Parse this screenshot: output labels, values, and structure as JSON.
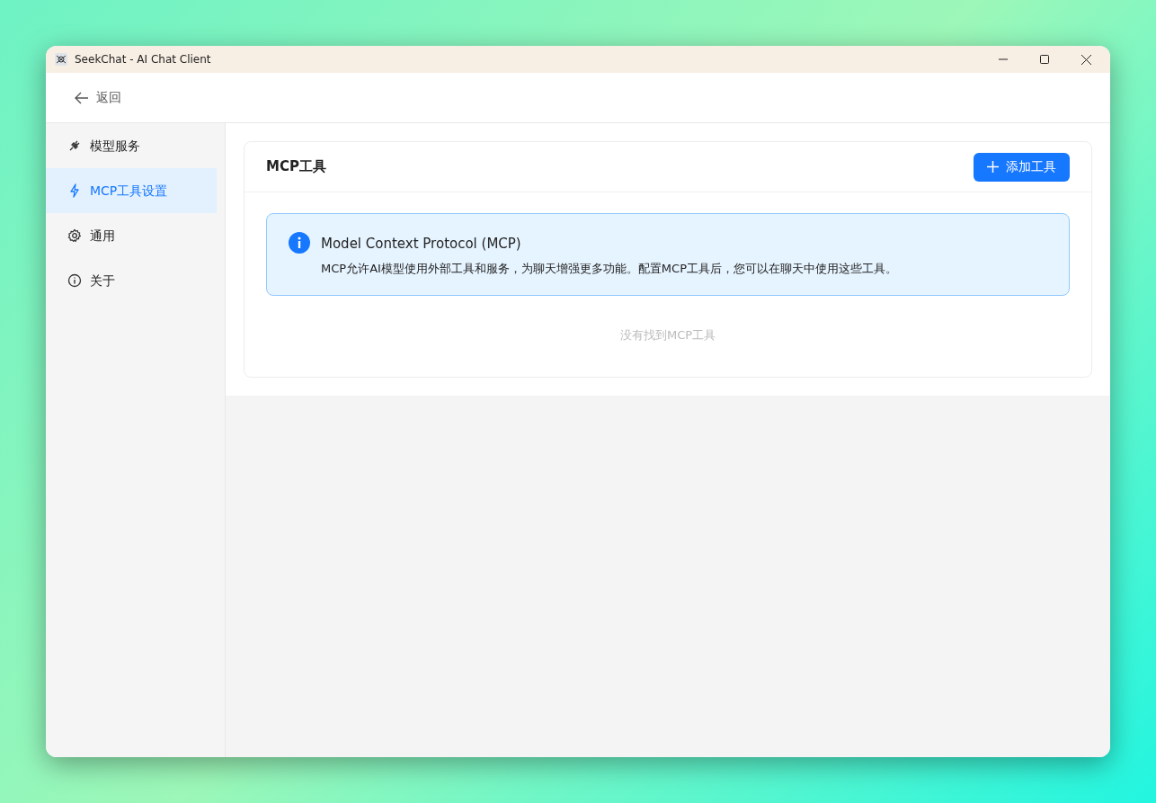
{
  "window": {
    "title": "SeekChat - AI Chat Client"
  },
  "back": {
    "label": "返回"
  },
  "sidebar": {
    "items": [
      {
        "label": "模型服务",
        "kind": "plug",
        "selected": false
      },
      {
        "label": "MCP工具设置",
        "kind": "bolt",
        "selected": true
      },
      {
        "label": "通用",
        "kind": "gear",
        "selected": false
      },
      {
        "label": "关于",
        "kind": "info",
        "selected": false
      }
    ]
  },
  "panel": {
    "title": "MCP工具",
    "add_button": "添加工具",
    "alert": {
      "title": "Model Context Protocol (MCP)",
      "text": "MCP允许AI模型使用外部工具和服务，为聊天增强更多功能。配置MCP工具后，您可以在聊天中使用这些工具。"
    },
    "empty_text": "没有找到MCP工具"
  }
}
